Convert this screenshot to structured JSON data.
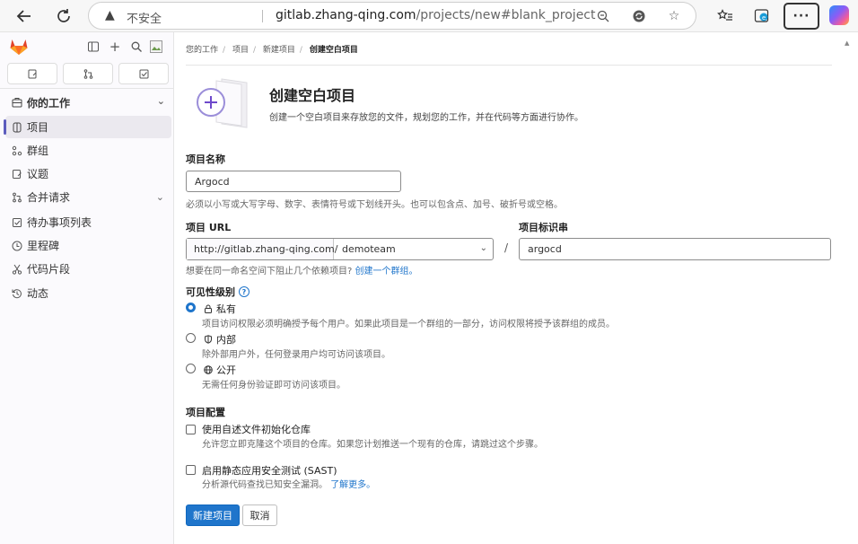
{
  "browser": {
    "security_label": "不安全",
    "url_host": "gitlab.zhang-qing.com",
    "url_path": "/projects/new#blank_project"
  },
  "sidebar": {
    "section_title": "你的工作",
    "items": [
      {
        "label": "项目",
        "icon": "project-icon"
      },
      {
        "label": "群组",
        "icon": "group-icon"
      },
      {
        "label": "议题",
        "icon": "issues-icon"
      },
      {
        "label": "合并请求",
        "icon": "merge-request-icon"
      },
      {
        "label": "待办事项列表",
        "icon": "todo-icon"
      },
      {
        "label": "里程碑",
        "icon": "milestone-icon"
      },
      {
        "label": "代码片段",
        "icon": "snippet-icon"
      },
      {
        "label": "动态",
        "icon": "activity-icon"
      }
    ]
  },
  "breadcrumb": [
    "您的工作",
    "项目",
    "新建项目",
    "创建空白项目"
  ],
  "page": {
    "title": "创建空白项目",
    "description": "创建一个空白项目来存放您的文件，规划您的工作，并在代码等方面进行协作。"
  },
  "form": {
    "project_name_label": "项目名称",
    "project_name_value": "Argocd",
    "project_name_hint": "必须以小写或大写字母、数字、表情符号或下划线开头。也可以包含点、加号、破折号或空格。",
    "project_url_label": "项目 URL",
    "url_prefix": "http://gitlab.zhang-qing.com/",
    "namespace_value": "demoteam",
    "url_separator": "/",
    "slug_label": "项目标识串",
    "slug_value": "argocd",
    "group_hint": "想要在同一命名空间下阻止几个依赖项目?",
    "group_hint_link": "创建一个群组。",
    "visibility_label": "可见性级别",
    "visibility_options": [
      {
        "label": "私有",
        "icon": "lock-icon",
        "desc": "项目访问权限必须明确授予每个用户。如果此项目是一个群组的一部分，访问权限将授予该群组的成员。",
        "checked": true
      },
      {
        "label": "内部",
        "icon": "shield-icon",
        "desc": "除外部用户外，任何登录用户均可访问该项目。",
        "checked": false
      },
      {
        "label": "公开",
        "icon": "globe-icon",
        "desc": "无需任何身份验证即可访问该项目。",
        "checked": false
      }
    ],
    "config_label": "项目配置",
    "readme_label": "使用自述文件初始化仓库",
    "readme_desc": "允许您立即克隆这个项目的仓库。如果您计划推送一个现有的仓库，请跳过这个步骤。",
    "sast_label": "启用静态应用安全测试 (SAST)",
    "sast_desc": "分析源代码查找已知安全漏洞。",
    "sast_link": "了解更多。",
    "submit_label": "新建项目",
    "cancel_label": "取消"
  }
}
